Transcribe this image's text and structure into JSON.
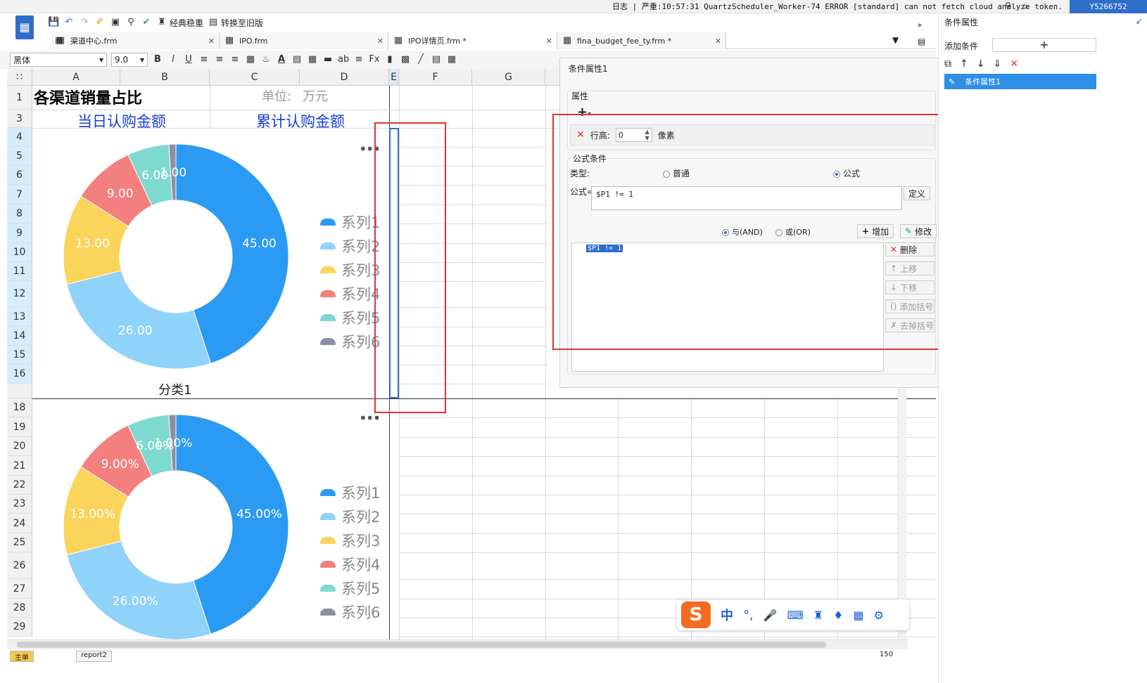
{
  "status": {
    "log_label": "日志",
    "log_message": "严重:10:57:31 QuartzScheduler_Worker-74 ERROR [standard] can not fetch cloud analyze token.",
    "user_id": "Y5266752"
  },
  "toolbar": {
    "classic_label": "经典稳重",
    "convert_label": "转换至旧版"
  },
  "tabs": [
    {
      "label": "渠道中心.frm"
    },
    {
      "label": "IPO.frm"
    },
    {
      "label": "IPO详情页.frm *"
    },
    {
      "label": "fina_budget_fee_ty.frm *"
    }
  ],
  "format": {
    "font_name": "黑体",
    "font_size": "9.0"
  },
  "columns": [
    "A",
    "B",
    "C",
    "D",
    "E",
    "F",
    "G"
  ],
  "rows": [
    "1",
    "3",
    "4",
    "5",
    "6",
    "7",
    "8",
    "9",
    "10",
    "11",
    "12",
    "13",
    "14",
    "15",
    "16",
    "18",
    "19",
    "20",
    "21",
    "22",
    "23",
    "24",
    "25",
    "26",
    "27",
    "28",
    "29"
  ],
  "sheet": {
    "title": "各渠道销量占比",
    "unit_label": "单位:",
    "unit_value": "万元",
    "header_left": "当日认购金额",
    "header_right": "累计认购金额",
    "category_label": "分类1"
  },
  "chart_data": [
    {
      "type": "pie",
      "categories": [
        "系列1",
        "系列2",
        "系列3",
        "系列4",
        "系列5",
        "系列6"
      ],
      "values": [
        45,
        26,
        13,
        9,
        6,
        1
      ],
      "labels": [
        "45.00",
        "26.00",
        "13.00",
        "9.00",
        "6.00",
        "1.00"
      ],
      "legend": "right"
    },
    {
      "type": "pie",
      "categories": [
        "系列1",
        "系列2",
        "系列3",
        "系列4",
        "系列5",
        "系列6"
      ],
      "values": [
        45,
        26,
        13,
        9,
        6,
        1
      ],
      "labels": [
        "45.00%",
        "26.00%",
        "13.00%",
        "9.00%",
        "6.00%",
        "1.00%"
      ],
      "legend": "right"
    }
  ],
  "colors": {
    "s1": "#2b9af3",
    "s2": "#8fd3fb",
    "s3": "#fbd45c",
    "s4": "#f47f7f",
    "s5": "#7ed9d0",
    "s6": "#8a8fa5",
    "red_highlight": "#e53232",
    "accent": "#2f6ec8"
  },
  "dialog": {
    "title": "条件属性1",
    "attr_label": "属性",
    "row_height_label": "行高:",
    "row_height_value": "0",
    "row_height_unit": "像素",
    "formula_section": "公式条件",
    "type_label": "类型:",
    "type_normal": "普通",
    "type_formula": "公式",
    "formula_label": "公式=",
    "formula_value": "$P1 != 1",
    "define_button": "定义",
    "and_label": "与(AND)",
    "or_label": "或(OR)",
    "add_button": "增加",
    "modify_button": "修改",
    "condition_item": "$P1 != 1",
    "delete_button": "删除",
    "up_button": "上移",
    "down_button": "下移",
    "add_bracket_button": "添加括号",
    "remove_bracket_button": "去掉括号"
  },
  "right_panel": {
    "title": "条件属性",
    "add_condition": "添加条件",
    "add_symbol": "+",
    "item": "条件属性1"
  },
  "sheet_tabs": [
    "主单",
    "report2"
  ],
  "zoom": "150"
}
